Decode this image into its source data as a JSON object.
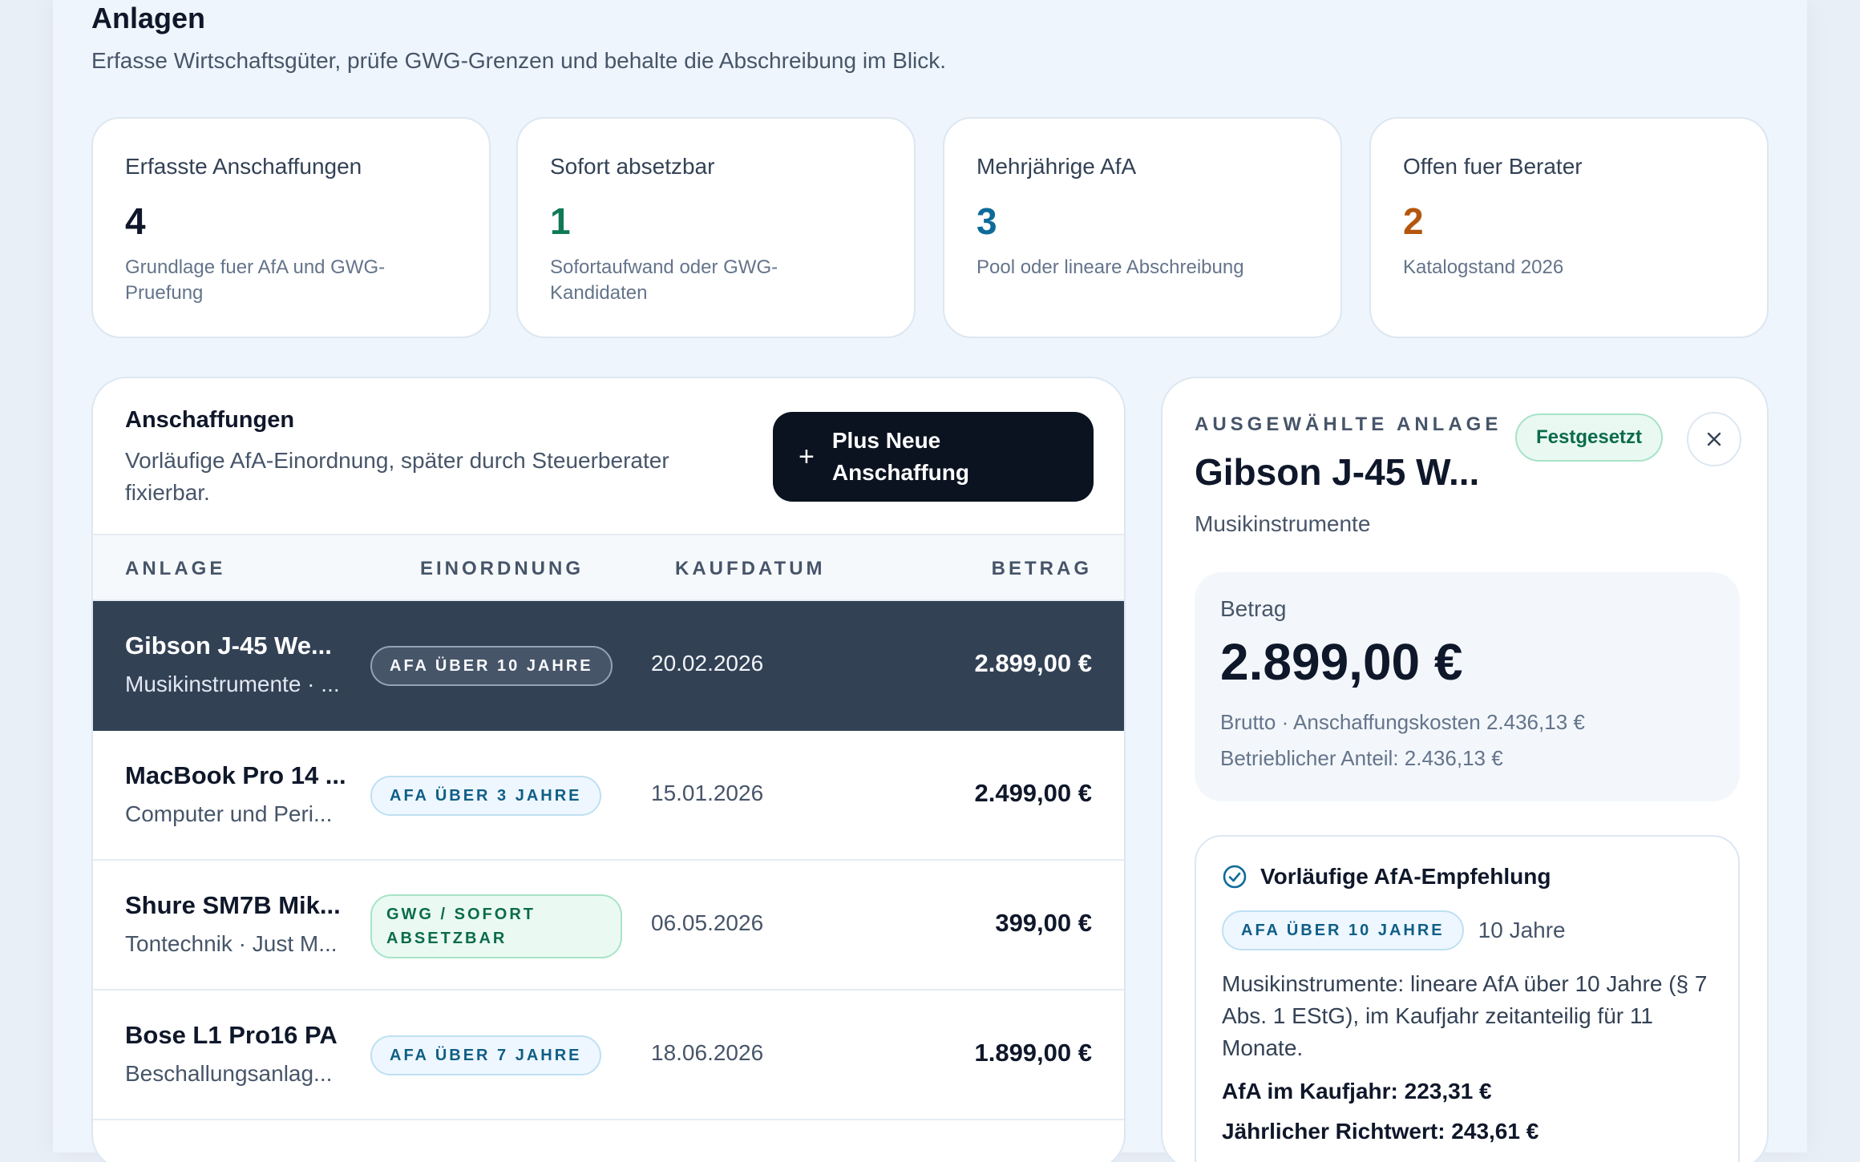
{
  "header": {
    "title": "Anlagen",
    "subtitle": "Erfasse Wirtschaftsgüter, prüfe GWG-Grenzen und behalte die Abschreibung im Blick."
  },
  "stats": [
    {
      "label": "Erfasste Anschaffungen",
      "value": "4",
      "hint": "Grundlage fuer AfA und GWG-Pruefung",
      "color": "#0f172a"
    },
    {
      "label": "Sofort absetzbar",
      "value": "1",
      "hint": "Sofortaufwand oder GWG-Kandidaten",
      "color": "#0e7a55"
    },
    {
      "label": "Mehrjährige AfA",
      "value": "3",
      "hint": "Pool oder lineare Abschreibung",
      "color": "#0d6b9a"
    },
    {
      "label": "Offen fuer Berater",
      "value": "2",
      "hint": "Katalogstand 2026",
      "color": "#b4570e"
    }
  ],
  "list": {
    "title": "Anschaffungen",
    "description": "Vorläufige AfA-Einordnung, später durch Steuerberater fixierbar.",
    "add_button": "Plus Neue Anschaffung",
    "columns": [
      "ANLAGE",
      "EINORDNUNG",
      "KAUFDATUM",
      "BETRAG"
    ],
    "rows": [
      {
        "name": "Gibson J-45 We...",
        "category": "Musikinstrumente · ...",
        "badge": "AFA ÜBER 10 JAHRE",
        "date": "20.02.2026",
        "amount": "2.899,00 €",
        "selected": true
      },
      {
        "name": "MacBook Pro 14 ...",
        "category": "Computer und Peri...",
        "badge": "AFA ÜBER 3 JAHRE",
        "date": "15.01.2026",
        "amount": "2.499,00 €",
        "selected": false
      },
      {
        "name": "Shure SM7B Mik...",
        "category": "Tontechnik · Just M...",
        "badge": "GWG / SOFORT ABSETZBAR",
        "date": "06.05.2026",
        "amount": "399,00 €",
        "selected": false
      },
      {
        "name": "Bose L1 Pro16 PA",
        "category": "Beschallungsanlag...",
        "badge": "AFA ÜBER 7 JAHRE",
        "date": "18.06.2026",
        "amount": "1.899,00 €",
        "selected": false
      }
    ]
  },
  "detail": {
    "eyebrow": "AUSGEWÄHLTE ANLAGE",
    "title": "Gibson J-45 W...",
    "category": "Musikinstrumente",
    "status": "Festgesetzt",
    "amount_label": "Betrag",
    "amount": "2.899,00 €",
    "gross_line": "Brutto · Anschaffungskosten 2.436,13 €",
    "business_share": "Betrieblicher Anteil: 2.436,13 €",
    "recommendation": {
      "title": "Vorläufige AfA-Empfehlung",
      "badge": "AFA ÜBER 10 JAHRE",
      "years": "10 Jahre",
      "text": "Musikinstrumente: lineare AfA über 10 Jahre (§ 7 Abs. 1 EStG), im Kaufjahr zeitanteilig für 11 Monate.",
      "purchase_year": "AfA im Kaufjahr: 223,31 €",
      "annual": "Jährlicher Richtwert: 243,61 €"
    }
  }
}
